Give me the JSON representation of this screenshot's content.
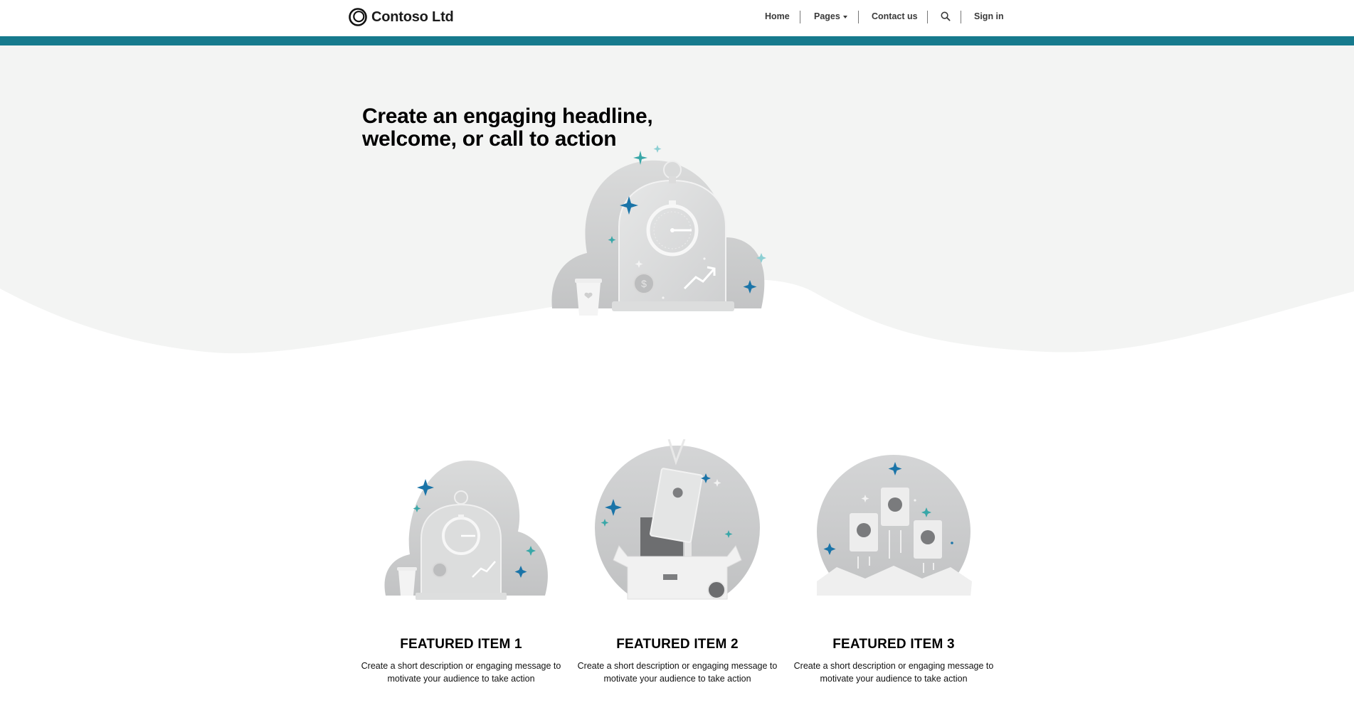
{
  "header": {
    "brand_name": "Contoso Ltd",
    "nav": {
      "home": "Home",
      "pages": "Pages",
      "contact": "Contact us",
      "sign_in": "Sign in"
    }
  },
  "colors": {
    "accent": "#167a8d",
    "hero_bg": "#f3f4f3",
    "sparkle_blue": "#1a74a8",
    "sparkle_teal": "#39a7a8"
  },
  "icons": {
    "logo": "contoso-ring-logo",
    "search": "search-icon",
    "pages_caret": "chevron-down-icon"
  },
  "hero": {
    "headline": "Create an engaging headline, welcome, or call to action"
  },
  "features": [
    {
      "title": "FEATURED ITEM 1",
      "description": "Create a short description or engaging message to motivate your audience to take action"
    },
    {
      "title": "FEATURED ITEM 2",
      "description": "Create a short description or engaging message to motivate your audience to take action"
    },
    {
      "title": "FEATURED ITEM 3",
      "description": "Create a short description or engaging message to motivate your audience to take action"
    }
  ]
}
